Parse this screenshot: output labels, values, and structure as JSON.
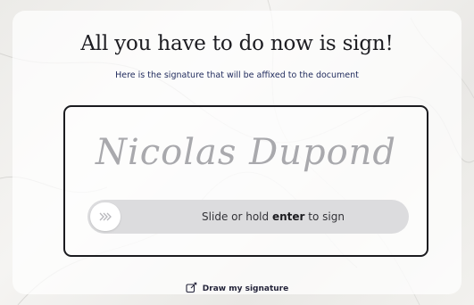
{
  "title": "All you have to do now is sign!",
  "subtitle": "Here is the signature that will be affixed to the document",
  "signature": {
    "name": "Nicolas Dupond"
  },
  "slider": {
    "text_before": "Slide or hold",
    "key": "enter",
    "text_after": "to sign",
    "icon": "chevrons-right-icon"
  },
  "draw": {
    "label": "Draw my signature",
    "icon": "edit-square-icon"
  },
  "colors": {
    "accent_dark": "#1b1b1f",
    "subtitle_text": "#1f2a5c",
    "signature_text": "#a9a9ad",
    "slider_track": "#dcdcde"
  }
}
